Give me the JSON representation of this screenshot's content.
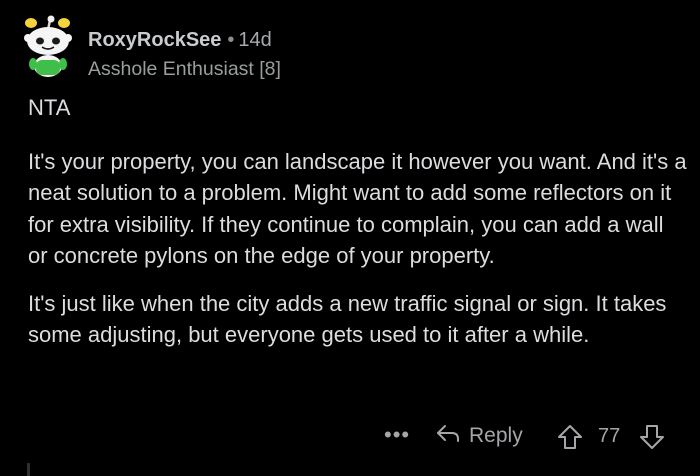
{
  "comment": {
    "username": "RoxyRockSee",
    "separator": "•",
    "time": "14d",
    "flair": "Asshole Enthusiast [8]",
    "paragraphs": [
      "NTA",
      "It's your property, you can landscape it however you want. And it's a neat solution to a problem. Might want to add some reflectors on it for extra visibility. If they continue to complain, you can add a wall or concrete pylons on the edge of your property.",
      "It's just like when the city adds a new traffic signal or sign. It takes some adjusting, but everyone gets used to it after a while."
    ],
    "actions": {
      "more": "•••",
      "reply_label": "Reply",
      "vote_count": "77"
    },
    "icons": {
      "avatar": "reddit-snoo-avatar-icon",
      "reply": "reply-arrow-icon",
      "upvote": "upvote-arrow-icon",
      "downvote": "downvote-arrow-icon"
    }
  }
}
